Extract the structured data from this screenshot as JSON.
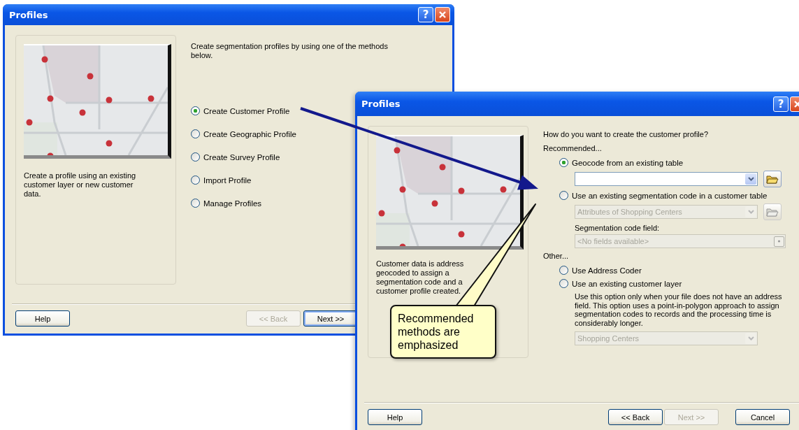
{
  "back_window": {
    "title": "Profiles",
    "title_help": "?",
    "description": "Create a profile using an existing customer layer or new customer data.",
    "intro": "Create segmentation profiles by using one of the methods below.",
    "options": [
      {
        "label": "Create Customer Profile",
        "selected": true
      },
      {
        "label": "Create Geographic Profile",
        "selected": false
      },
      {
        "label": "Create Survey Profile",
        "selected": false
      },
      {
        "label": "Import Profile",
        "selected": false
      },
      {
        "label": "Manage Profiles",
        "selected": false
      }
    ],
    "buttons": [
      {
        "label": "Help",
        "disabled": false,
        "default": false
      },
      {
        "label": "<< Back",
        "disabled": true,
        "default": false
      },
      {
        "label": "Next >>",
        "disabled": false,
        "default": true
      }
    ]
  },
  "front_window": {
    "title": "Profiles",
    "title_help": "?",
    "description": "Customer data is address geocoded to assign a segmentation code and a customer profile created.",
    "question": "How do you want to create the customer profile?",
    "groups": [
      {
        "heading": "Recommended...",
        "options": [
          {
            "label": "Geocode from an existing table",
            "selected": true,
            "controls": [
              {
                "kind": "combo",
                "disabled": false,
                "browse": true
              }
            ]
          },
          {
            "label": "Use an existing segmentation code in a customer table",
            "selected": false,
            "controls": [
              {
                "kind": "combo",
                "value": "Attributes of Shopping Centers",
                "disabled": true,
                "browse": true
              },
              {
                "kind": "label",
                "text": "Segmentation code field:"
              },
              {
                "kind": "list",
                "value": "<No fields available>",
                "disabled": true
              }
            ]
          }
        ]
      },
      {
        "heading": "Other...",
        "options": [
          {
            "label": "Use Address Coder",
            "selected": false
          },
          {
            "label": "Use an existing customer layer",
            "selected": false,
            "controls": [
              {
                "kind": "note",
                "text": "Use this option only when your file does not have an address field. This option uses a point-in-polygon approach to assign segmentation codes to records and the processing time is considerably longer."
              },
              {
                "kind": "combo",
                "value": "Shopping Centers",
                "disabled": true
              }
            ]
          }
        ]
      }
    ],
    "buttons": [
      {
        "label": "Help",
        "disabled": false,
        "default": false
      },
      {
        "label": "<< Back",
        "disabled": false,
        "default": false
      },
      {
        "label": "Next >>",
        "disabled": true,
        "default": false
      },
      {
        "label": "Cancel",
        "disabled": false,
        "default": false
      }
    ]
  },
  "callout": {
    "text": "Recommended methods are emphasized"
  }
}
